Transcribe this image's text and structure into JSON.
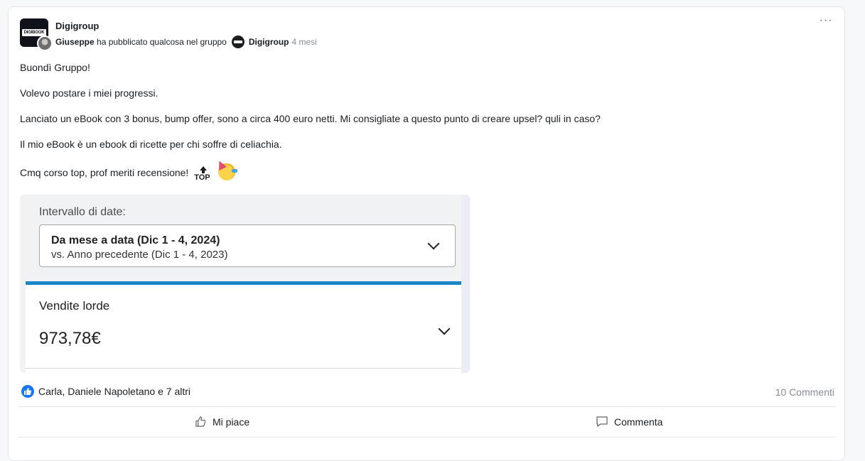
{
  "post": {
    "group_name": "Digigroup",
    "group_logo_text": "DIGIBOOK",
    "author": "Giuseppe",
    "action_text": "ha pubblicato qualcosa nel gruppo",
    "group_link": "Digigroup",
    "time": "4 mesi",
    "more_label": "···",
    "paragraphs": [
      "Buondì Gruppo!",
      "Volevo postare i miei progressi.",
      "Lanciato un eBook con 3 bonus, bump offer, sono a circa 400 euro netti. Mi consigliate a questo punto di creare upsel? quli in caso?",
      "Il mio eBook è un ebook di ricette per chi soffre di celiachia.",
      "Cmq corso top, prof meriti recensione!"
    ],
    "emoji_top_label": "TOP"
  },
  "image": {
    "range_label": "Intervallo di date:",
    "range_main": "Da mese a data (Dic 1 - 4, 2024)",
    "range_sub": "vs. Anno precedente (Dic 1 - 4, 2023)",
    "metric_title": "Vendite lorde",
    "metric_value": "973,78€"
  },
  "footer": {
    "reactors": "Carla, Daniele Napoletano e 7 altri",
    "comments_count": "10 Commenti",
    "like_label": "Mi piace",
    "comment_label": "Commenta"
  },
  "colors": {
    "accent": "#1877f2",
    "image_top_bar": "#1a86c8"
  }
}
